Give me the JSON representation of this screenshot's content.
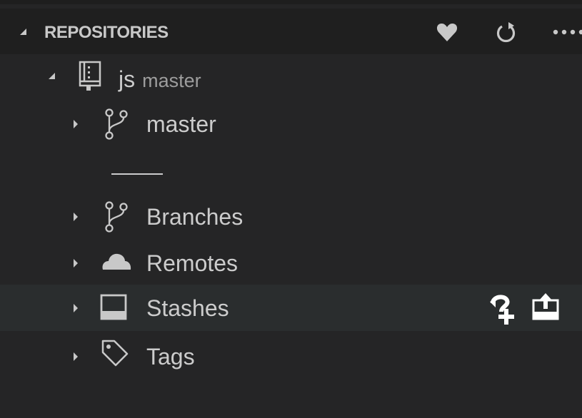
{
  "header": {
    "title": "REPOSITORIES",
    "actions": [
      {
        "icon": "heart-icon"
      },
      {
        "icon": "refresh-icon"
      },
      {
        "icon": "more-icon"
      }
    ]
  },
  "repository": {
    "name": "js",
    "branch": "master",
    "icon": "repo-icon"
  },
  "tree": {
    "current_branch": {
      "label": "master",
      "icon": "git-branch-icon"
    },
    "branches": {
      "label": "Branches",
      "icon": "git-branch-icon"
    },
    "remotes": {
      "label": "Remotes",
      "icon": "cloud-icon"
    },
    "stashes": {
      "label": "Stashes",
      "icon": "inbox-icon",
      "actions": [
        {
          "icon": "stash-save-icon"
        },
        {
          "icon": "stash-apply-icon"
        }
      ]
    },
    "tags": {
      "label": "Tags",
      "icon": "tag-icon"
    }
  },
  "colors": {
    "background": "#252526",
    "header_background": "#1f1f1f",
    "selected_row": "#2a2d2e",
    "text": "#cccccc",
    "description": "#9d9d9d"
  }
}
